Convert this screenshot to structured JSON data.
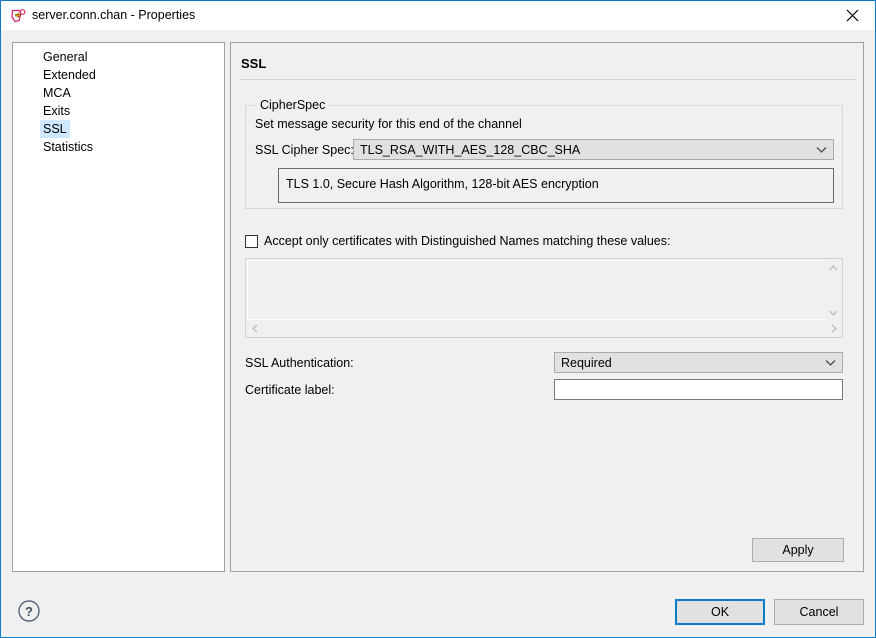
{
  "window": {
    "title": "server.conn.chan - Properties",
    "icon": "channel-properties-icon",
    "close_label": "close-icon",
    "accent_color": "#0c7cc4",
    "background_color": "#f0f0f0"
  },
  "sidebar": {
    "items": [
      {
        "label": "General",
        "selected": false
      },
      {
        "label": "Extended",
        "selected": false
      },
      {
        "label": "MCA",
        "selected": false
      },
      {
        "label": "Exits",
        "selected": false
      },
      {
        "label": "SSL",
        "selected": true
      },
      {
        "label": "Statistics",
        "selected": false
      }
    ],
    "selection_color": "#cde8ff"
  },
  "main": {
    "page_title": "SSL",
    "groupbox": {
      "legend": "CipherSpec",
      "description": "Set message security for this end of the channel",
      "cipher_spec_label": "SSL Cipher Spec:",
      "cipher_spec_value": "TLS_RSA_WITH_AES_128_CBC_SHA",
      "cipher_spec_description": "TLS 1.0, Secure Hash Algorithm, 128-bit AES encryption"
    },
    "distinguished_names": {
      "checkbox_label": "Accept only certificates with Distinguished Names matching these values:",
      "checked": false,
      "list_value": "",
      "list_enabled": false,
      "scroll_up_icon": "chevron-up-icon",
      "scroll_down_icon": "chevron-down-icon",
      "scroll_left_icon": "chevron-left-icon",
      "scroll_right_icon": "chevron-right-icon"
    },
    "ssl_authentication_label": "SSL Authentication:",
    "ssl_authentication_value": "Required",
    "certificate_label_label": "Certificate label:",
    "certificate_label_value": "",
    "certificate_label_placeholder": "",
    "apply_label": "Apply"
  },
  "footer": {
    "help_icon": "help-circle-icon",
    "ok_label": "OK",
    "cancel_label": "Cancel"
  }
}
